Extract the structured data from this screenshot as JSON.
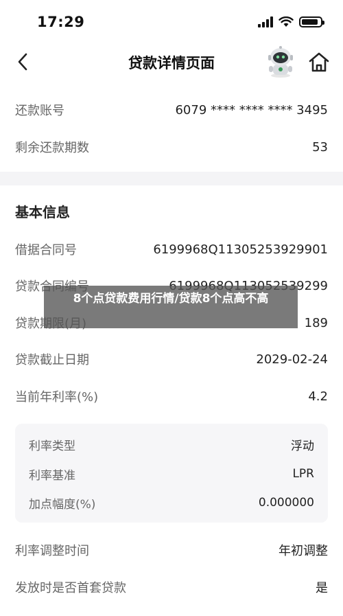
{
  "status_bar": {
    "time": "17:29",
    "battery_level": 0.9
  },
  "nav": {
    "title": "贷款详情页面"
  },
  "top_rows": [
    {
      "label": "还款账号",
      "value": "6079 **** **** **** 3495"
    },
    {
      "label": "剩余还款期数",
      "value": "53"
    }
  ],
  "basic_info": {
    "title": "基本信息",
    "rows": [
      {
        "label": "借据合同号",
        "value": "6199968Q11305253929901"
      },
      {
        "label": "贷款合同编号",
        "value": "6199968Q113052539299"
      },
      {
        "label": "贷款期限(月)",
        "value": "189"
      },
      {
        "label": "贷款截止日期",
        "value": "2029-02-24"
      },
      {
        "label": "当前年利率(%)",
        "value": "4.2"
      }
    ]
  },
  "rate_box": {
    "rows": [
      {
        "label": "利率类型",
        "value": "浮动"
      },
      {
        "label": "利率基准",
        "value": "LPR"
      },
      {
        "label": "加点幅度(%)",
        "value": "0.000000"
      }
    ]
  },
  "bottom_rows": [
    {
      "label": "利率调整时间",
      "value": "年初调整"
    },
    {
      "label": "发放时是否首套贷款",
      "value": "是"
    }
  ],
  "watermark": {
    "text": "8个点贷款费用行情/贷款8个点高不高"
  },
  "icons": {
    "back": "chevron-left-icon",
    "assistant": "robot-assistant-icon",
    "home": "home-icon",
    "signal": "cellular-signal-icon",
    "wifi": "wifi-icon",
    "battery": "battery-icon"
  }
}
